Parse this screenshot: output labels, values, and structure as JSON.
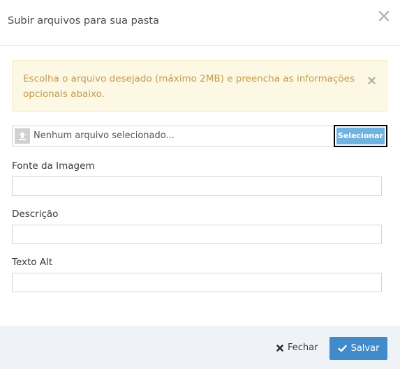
{
  "modal": {
    "title": "Subir arquivos para sua pasta"
  },
  "alert": {
    "message": "Escolha o arquivo desejado (máximo 2MB) e preencha as informações opcionais abaixo."
  },
  "file_input": {
    "placeholder": "Nenhum arquivo selecionado...",
    "button_label": "Selecionar"
  },
  "fields": [
    {
      "label": "Fonte da Imagem",
      "value": ""
    },
    {
      "label": "Descrição",
      "value": ""
    },
    {
      "label": "Texto Alt",
      "value": ""
    }
  ],
  "footer": {
    "close_label": "Fechar",
    "save_label": "Salvar"
  },
  "icons": {
    "header_close": "close-icon",
    "alert_close": "close-icon",
    "upload": "upload-icon",
    "footer_close": "times-icon",
    "save": "check-icon"
  },
  "colors": {
    "alert_bg": "#fcf8e3",
    "alert_text": "#c49a4e",
    "select_button": "#6fb3e0",
    "save_button": "#428bca",
    "footer_bg": "#eff3f8"
  }
}
